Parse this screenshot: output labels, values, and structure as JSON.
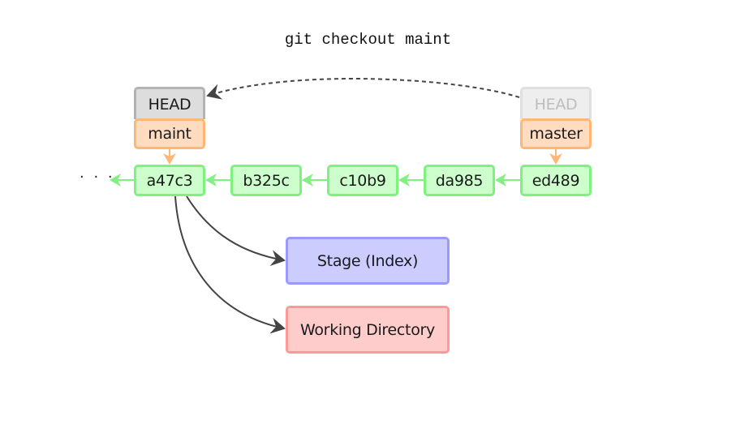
{
  "title": "git checkout maint",
  "refs": {
    "head_current": "HEAD",
    "head_previous": "HEAD",
    "branch_current": "maint",
    "branch_previous": "master"
  },
  "history_ellipsis": "· · ·",
  "commits": [
    "a47c3",
    "b325c",
    "c10b9",
    "da985",
    "ed489"
  ],
  "areas": {
    "stage": "Stage (Index)",
    "working_directory": "Working Directory"
  },
  "colors": {
    "commit_fill": "#ccffcc",
    "commit_border": "#80f080",
    "branch_fill": "#ffdcbf",
    "branch_border": "#ffb778",
    "head_fill": "#dddddd",
    "head_border": "#b3b3b3",
    "stage_fill": "#ccccff",
    "stage_border": "#9999ff",
    "workdir_fill": "#ffcccc",
    "workdir_border": "#ff9999"
  }
}
